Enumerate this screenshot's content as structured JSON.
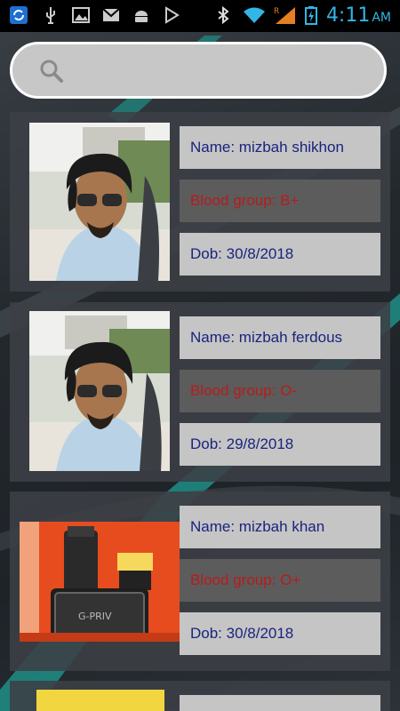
{
  "statusbar": {
    "time": "4:11",
    "ampm": "AM",
    "icons": [
      "sync-icon",
      "usb-icon",
      "gallery-icon",
      "gmail-icon",
      "android-icon",
      "play-store-icon",
      "bluetooth-icon",
      "wifi-icon",
      "signal-icon",
      "battery-icon"
    ]
  },
  "search": {
    "value": "",
    "placeholder": ""
  },
  "people": [
    {
      "name": "Name: mizbah shikhon",
      "blood": "Blood group: B+",
      "dob": "Dob: 30/8/2018",
      "photo": "selfie"
    },
    {
      "name": "Name: mizbah ferdous",
      "blood": "Blood group: O-",
      "dob": "Dob: 29/8/2018",
      "photo": "selfie"
    },
    {
      "name": "Name: mizbah khan",
      "blood": "Blood group: O+",
      "dob": "Dob: 30/8/2018",
      "photo": "device",
      "photo_text": "G-PRIV"
    }
  ],
  "colors": {
    "name_text": "#1a237e",
    "blood_text": "#b71c1c",
    "accent": "#33b5e5"
  }
}
